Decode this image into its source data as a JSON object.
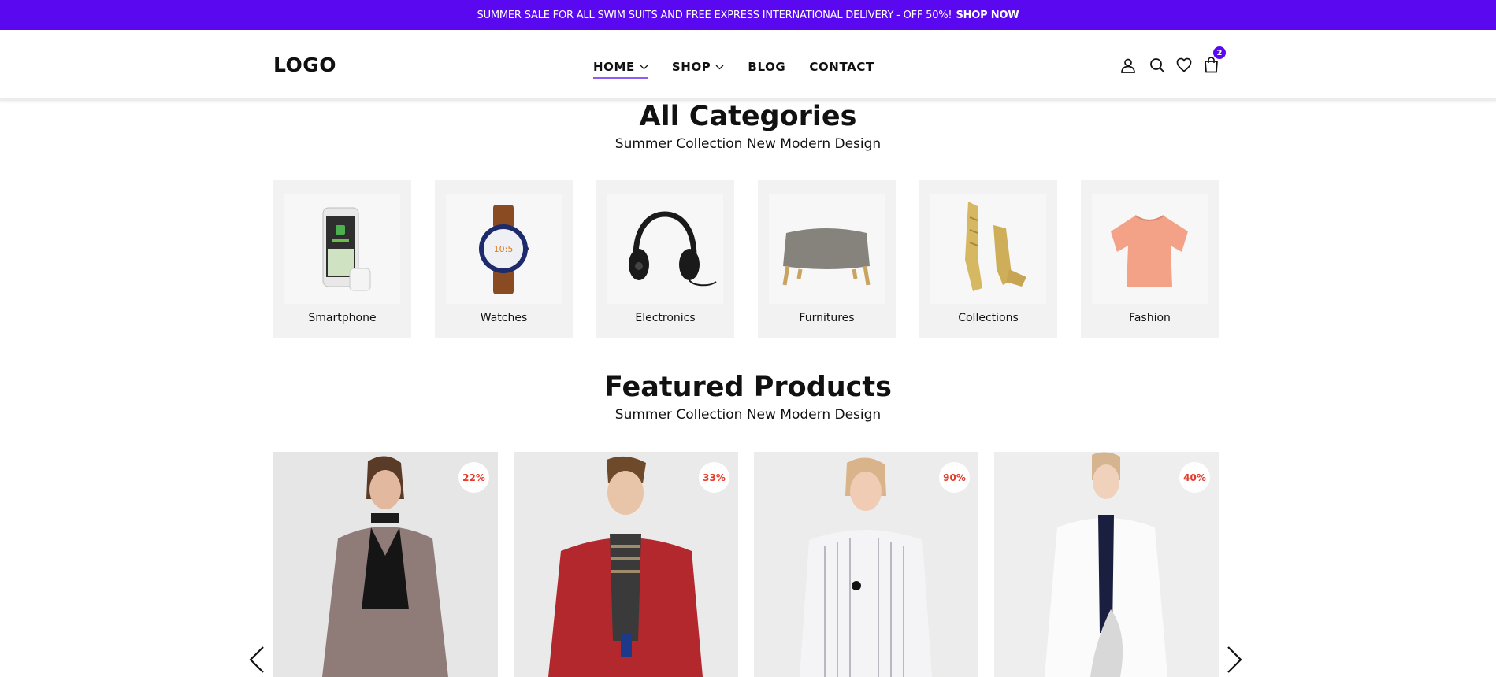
{
  "announcement": {
    "text": "SUMMER SALE FOR ALL SWIM SUITS AND FREE EXPRESS INTERNATIONAL DELIVERY - OFF 50%!",
    "link": "SHOP NOW"
  },
  "header": {
    "logo": "LOGO",
    "nav": [
      {
        "label": "HOME",
        "dropdown": true,
        "active": true
      },
      {
        "label": "SHOP",
        "dropdown": true,
        "active": false
      },
      {
        "label": "BLOG",
        "dropdown": false,
        "active": false
      },
      {
        "label": "CONTACT",
        "dropdown": false,
        "active": false
      }
    ],
    "icons": [
      "user-icon",
      "search-icon",
      "heart-icon",
      "cart-icon"
    ],
    "cart_count": "2"
  },
  "categories": {
    "title": "All Categories",
    "subtitle": "Summer Collection New Modern Design",
    "items": [
      {
        "label": "Smartphone",
        "icon": "smartphone-image"
      },
      {
        "label": "Watches",
        "icon": "watch-image"
      },
      {
        "label": "Electronics",
        "icon": "headphones-image"
      },
      {
        "label": "Furnitures",
        "icon": "ottoman-image"
      },
      {
        "label": "Collections",
        "icon": "sandals-image"
      },
      {
        "label": "Fashion",
        "icon": "blouse-image"
      }
    ]
  },
  "featured": {
    "title": "Featured Products",
    "subtitle": "Summer Collection New Modern Design",
    "products": [
      {
        "discount": "22%",
        "image": "woman-plaid-coat-image"
      },
      {
        "discount": "33%",
        "image": "man-plaid-shirt-image"
      },
      {
        "discount": "90%",
        "image": "woman-striped-dress-image"
      },
      {
        "discount": "40%",
        "image": "woman-white-dress-image"
      }
    ]
  },
  "colors": {
    "accent": "#5a08ef",
    "discount": "#e23b2a",
    "card_bg": "#f2f2f2",
    "underline": "#8b5cf6"
  }
}
